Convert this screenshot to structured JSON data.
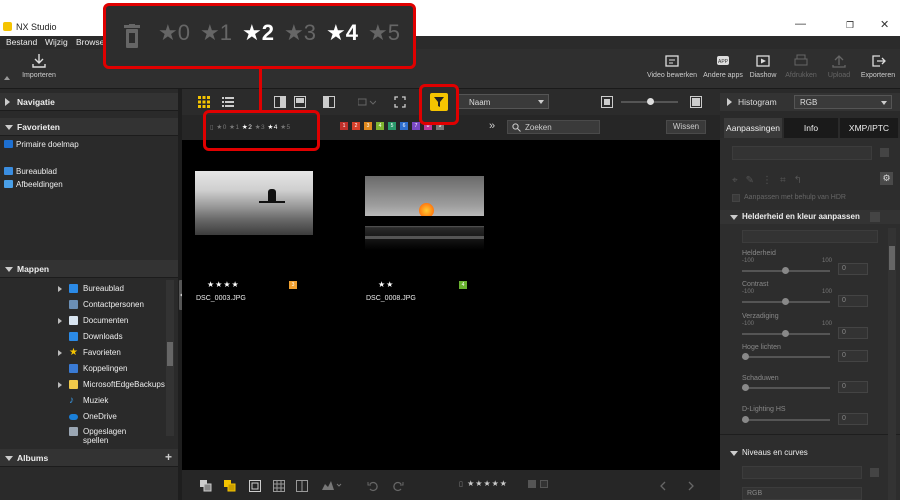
{
  "window": {
    "title": "NX Studio"
  },
  "menu": [
    "Bestand",
    "Wijzig",
    "Browser"
  ],
  "toolbar": {
    "import_label": "Importeren",
    "right_items": [
      "Video bewerken",
      "Andere apps",
      "Diashow",
      "Afdrukken",
      "Upload",
      "Exporteren"
    ],
    "app_badge": "APP"
  },
  "left_panel": {
    "navigation": "Navigatie",
    "favorites": "Favorieten",
    "fav_items": [
      "Primaire doelmap",
      "Bureaublad",
      "Afbeeldingen"
    ],
    "folders": "Mappen",
    "tree": [
      "Bureaublad",
      "Contactpersonen",
      "Documenten",
      "Downloads",
      "Favorieten",
      "Koppelingen",
      "MicrosoftEdgeBackups",
      "Muziek",
      "OneDrive",
      "Opgeslagen spellen"
    ],
    "albums": "Albums"
  },
  "center": {
    "sort_label": "Naam",
    "search_placeholder": "Zoeken",
    "clear_label": "Wissen",
    "rating_filter": [
      "★0",
      "★1",
      "★2",
      "★3",
      "★4",
      "★5"
    ],
    "label_colors": [
      "1",
      "2",
      "3",
      "4",
      "5",
      "6",
      "7",
      "8",
      "9"
    ],
    "more": "»",
    "thumbnails": [
      {
        "filename": "DSC_0003.JPG",
        "stars": "★★★★",
        "label": "3"
      },
      {
        "filename": "DSC_0008.JPG",
        "stars": "★★",
        "label": "4"
      }
    ]
  },
  "right_panel": {
    "histogram": "Histogram",
    "histogram_mode": "RGB",
    "tabs": [
      "Aanpassingen",
      "Info",
      "XMP/IPTC"
    ],
    "hdr_label": "Aanpassen met behulp van HDR",
    "section_title": "Helderheid en kleur aanpassen",
    "sliders": [
      {
        "label": "Helderheid",
        "min": "-100",
        "max": "100",
        "value": "0"
      },
      {
        "label": "Contrast",
        "min": "-100",
        "max": "100",
        "value": "0"
      },
      {
        "label": "Verzadiging",
        "min": "-100",
        "max": "100",
        "value": "0"
      },
      {
        "label": "Hoge lichten",
        "value": "0"
      },
      {
        "label": "Schaduwen",
        "value": "0"
      },
      {
        "label": "D-Lighting HS",
        "value": "0"
      }
    ],
    "levels": "Niveaus en curves",
    "rgb_bottom": "RGB"
  },
  "colors": {
    "accent": "#f5c400",
    "callout": "#e00000"
  }
}
